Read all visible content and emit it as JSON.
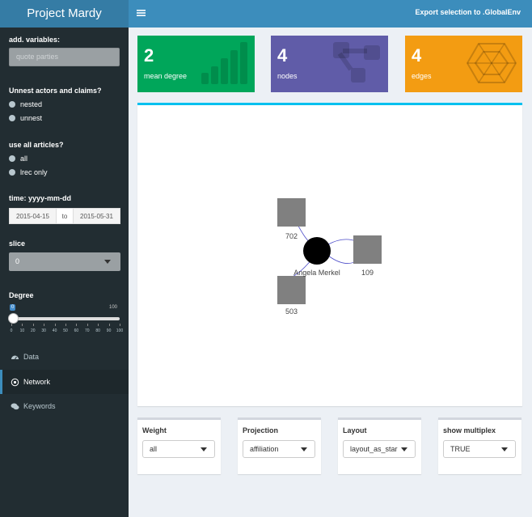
{
  "header": {
    "app_title": "Project Mardy",
    "menu_icon": "hamburger-icon",
    "export_label": "Export selection to .GlobalEnv"
  },
  "sidebar": {
    "add_variables": {
      "label": "add. variables:",
      "placeholder": "quote   parties"
    },
    "unnest": {
      "label": "Unnest actors and claims?",
      "options": [
        "nested",
        "unnest"
      ]
    },
    "articles": {
      "label": "use all articles?",
      "options": [
        "all",
        "lrec only"
      ]
    },
    "time": {
      "label": "time: yyyy-mm-dd",
      "start": "2015-04-15",
      "sep": "to",
      "end": "2015-05-31"
    },
    "slice": {
      "label": "slice",
      "value": "0"
    },
    "degree": {
      "label": "Degree",
      "value": "0",
      "min": 0,
      "max": "100",
      "ticks": [
        "0",
        "10",
        "20",
        "30",
        "40",
        "50",
        "60",
        "70",
        "80",
        "90",
        "100"
      ]
    },
    "menu": [
      {
        "label": "Data",
        "icon": "dashboard-icon",
        "active": false
      },
      {
        "label": "Network",
        "icon": "network-icon",
        "active": true
      },
      {
        "label": "Keywords",
        "icon": "comments-icon",
        "active": false
      }
    ]
  },
  "value_boxes": [
    {
      "value": "2",
      "label": "mean degree",
      "color": "#00a65a",
      "icon": "bar-chart-icon"
    },
    {
      "value": "4",
      "label": "nodes",
      "color": "#605ca8",
      "icon": "nodes-icon"
    },
    {
      "value": "4",
      "label": "edges",
      "color": "#f39c12",
      "icon": "hexagon-icon"
    }
  ],
  "network": {
    "nodes": [
      {
        "label": "702",
        "shape": "square",
        "color": "#808080"
      },
      {
        "label": "Angela Merkel",
        "shape": "circle",
        "color": "#000000"
      },
      {
        "label": "109",
        "shape": "square",
        "color": "#808080"
      },
      {
        "label": "503",
        "shape": "square",
        "color": "#808080"
      }
    ],
    "edge_color": "#4b4bc8"
  },
  "controls": {
    "weight": {
      "label": "Weight",
      "value": "all"
    },
    "projection": {
      "label": "Projection",
      "value": "affiliation"
    },
    "layout": {
      "label": "Layout",
      "value": "layout_as_star"
    },
    "multiplex": {
      "label": "show multiplex",
      "value": "TRUE"
    }
  }
}
